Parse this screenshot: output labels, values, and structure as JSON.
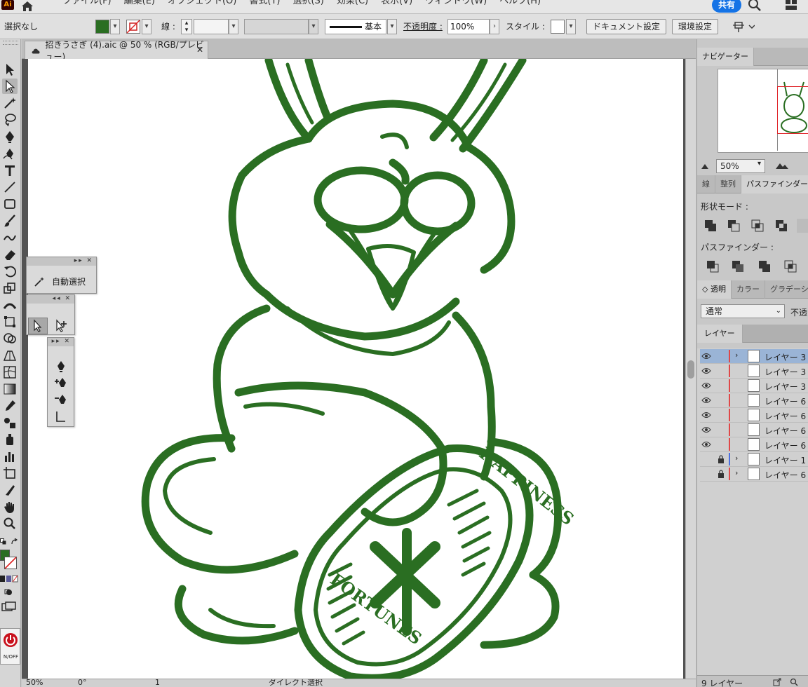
{
  "menubar": {
    "logo": "Ai",
    "items": [
      "ファイル(F)",
      "編集(E)",
      "オブジェクト(O)",
      "書式(T)",
      "選択(S)",
      "効果(C)",
      "表示(V)",
      "ウィンドウ(W)",
      "ヘルプ(H)"
    ],
    "share_label": "共有"
  },
  "controlbar": {
    "selection_label": "選択なし",
    "fill_color": "#2a6e22",
    "stroke_label": "線 :",
    "brush_label": "基本",
    "opacity_label": "不透明度 :",
    "opacity_value": "100%",
    "style_label": "スタイル :",
    "doc_setup_label": "ドキュメント設定",
    "prefs_label": "環境設定"
  },
  "document": {
    "tab_title": "招きうさぎ (4).aic @ 50 % (RGB/プレビュー)",
    "art_color": "#2a6e22"
  },
  "floating": {
    "magic_wand_label": "自動選択"
  },
  "statusbar": {
    "zoom": "50%",
    "rotation": "0°",
    "artboard": "1",
    "tool": "ダイレクト選択"
  },
  "navigator": {
    "tab_label": "ナビゲーター",
    "zoom": "50%"
  },
  "pathfinder_panel": {
    "tabs": [
      "線",
      "整列",
      "パスファインダー"
    ],
    "shape_modes_label": "形状モード :",
    "pathfinders_label": "パスファインダー :"
  },
  "transparency_panel": {
    "tabs": [
      "透明",
      "カラー",
      "グラデーション"
    ],
    "blend_mode": "通常",
    "opacity_label": "不透"
  },
  "layers_panel": {
    "tab_label": "レイヤー",
    "count_label": "9 レイヤー",
    "layers": [
      {
        "name": "レイヤー 3",
        "visible": true,
        "locked": false,
        "expandable": true,
        "selected": true,
        "color": "#e04848"
      },
      {
        "name": "レイヤー 3",
        "visible": true,
        "locked": false,
        "expandable": false,
        "selected": false,
        "color": "#e04848"
      },
      {
        "name": "レイヤー 3",
        "visible": true,
        "locked": false,
        "expandable": false,
        "selected": false,
        "color": "#e04848"
      },
      {
        "name": "レイヤー 6",
        "visible": true,
        "locked": false,
        "expandable": false,
        "selected": false,
        "color": "#e04848"
      },
      {
        "name": "レイヤー 6",
        "visible": true,
        "locked": false,
        "expandable": false,
        "selected": false,
        "color": "#e04848"
      },
      {
        "name": "レイヤー 6",
        "visible": true,
        "locked": false,
        "expandable": false,
        "selected": false,
        "color": "#e04848"
      },
      {
        "name": "レイヤー 6",
        "visible": true,
        "locked": false,
        "expandable": false,
        "selected": false,
        "color": "#e04848"
      },
      {
        "name": "レイヤー 1",
        "visible": false,
        "locked": true,
        "expandable": true,
        "selected": false,
        "color": "#4a6ee0"
      },
      {
        "name": "レイヤー 6",
        "visible": false,
        "locked": true,
        "expandable": true,
        "selected": false,
        "color": "#e04848"
      }
    ]
  },
  "artwork": {
    "badge_top_text": "HAPPINESS",
    "badge_bottom_text": "FORTUNES"
  }
}
